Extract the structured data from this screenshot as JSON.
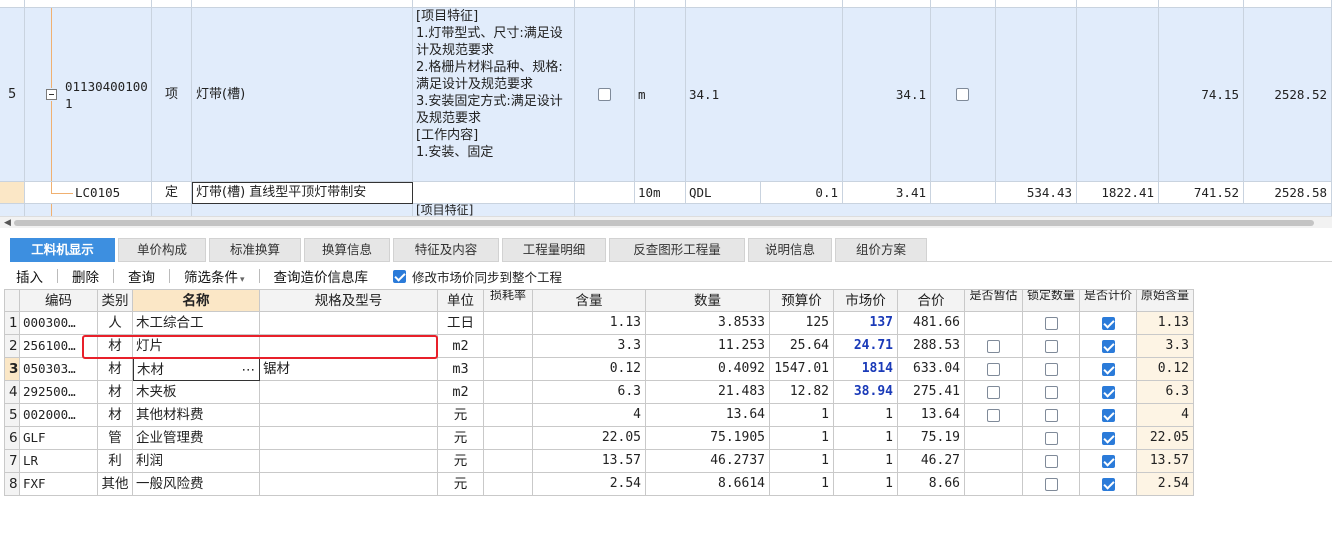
{
  "upper": {
    "row5": {
      "index": "5",
      "code": "011304001001",
      "type": "项",
      "name": "灯带(槽)",
      "features": [
        "[项目特征]",
        "1.灯带型式、尺寸:满足设计及规范要求",
        "2.格栅片材料品种、规格:满足设计及规范要求",
        "3.安装固定方式:满足设计及规范要求",
        "[工作内容]",
        "1.安装、固定"
      ],
      "unit": "m",
      "qty_expr": "34.1",
      "qty": "34.1",
      "unit_price": "74.15",
      "total": "2528.52"
    },
    "sub": {
      "code": "LC0105",
      "type": "定",
      "name": "灯带(槽) 直线型平顶灯带制安",
      "unit": "10m",
      "qty_expr": "QDL",
      "content": "0.1",
      "qty": "3.41",
      "labor": "534.43",
      "material": "1822.41",
      "unit_price": "741.52",
      "total": "2528.58"
    },
    "next_feature": "[项目特征]"
  },
  "tabs": [
    "工料机显示",
    "单价构成",
    "标准换算",
    "换算信息",
    "特征及内容",
    "工程量明细",
    "反查图形工程量",
    "说明信息",
    "组价方案"
  ],
  "toolbar": {
    "insert": "插入",
    "delete": "删除",
    "query": "查询",
    "filter": "筛选条件",
    "query_db": "查询造价信息库",
    "sync_label": "修改市场价同步到整个工程"
  },
  "lower": {
    "headers": {
      "code": "编码",
      "category": "类别",
      "name": "名称",
      "spec": "规格及型号",
      "unit": "单位",
      "loss": "损耗率",
      "content": "含量",
      "qty": "数量",
      "budget": "预算价",
      "market": "市场价",
      "total": "合价",
      "est": "是否暂估",
      "lock": "锁定数量",
      "pricing": "是否计价",
      "orig": "原始含量"
    },
    "rows": [
      {
        "no": "1",
        "code": "000300…",
        "cat": "人",
        "name": "木工综合工",
        "spec": "",
        "unit": "工日",
        "content": "1.13",
        "qty": "3.8533",
        "budget": "125",
        "market": "137",
        "total": "481.66",
        "est": null,
        "lock": false,
        "pricing": true,
        "orig": "1.13"
      },
      {
        "no": "2",
        "code": "256100…",
        "cat": "材",
        "name": "灯片",
        "spec": "",
        "unit": "m2",
        "content": "3.3",
        "qty": "11.253",
        "budget": "25.64",
        "market": "24.71",
        "total": "288.53",
        "est": false,
        "lock": false,
        "pricing": true,
        "orig": "3.3"
      },
      {
        "no": "3",
        "code": "050303…",
        "cat": "材",
        "name": "木材",
        "spec": "锯材",
        "unit": "m3",
        "content": "0.12",
        "qty": "0.4092",
        "budget": "1547.01",
        "market": "1814",
        "total": "633.04",
        "est": false,
        "lock": false,
        "pricing": true,
        "orig": "0.12"
      },
      {
        "no": "4",
        "code": "292500…",
        "cat": "材",
        "name": "木夹板",
        "spec": "",
        "unit": "m2",
        "content": "6.3",
        "qty": "21.483",
        "budget": "12.82",
        "market": "38.94",
        "total": "275.41",
        "est": false,
        "lock": false,
        "pricing": true,
        "orig": "6.3"
      },
      {
        "no": "5",
        "code": "002000…",
        "cat": "材",
        "name": "其他材料费",
        "spec": "",
        "unit": "元",
        "content": "4",
        "qty": "13.64",
        "budget": "1",
        "market": "1",
        "total": "13.64",
        "est": false,
        "lock": false,
        "pricing": true,
        "orig": "4"
      },
      {
        "no": "6",
        "code": "GLF",
        "cat": "管",
        "name": "企业管理费",
        "spec": "",
        "unit": "元",
        "content": "22.05",
        "qty": "75.1905",
        "budget": "1",
        "market": "1",
        "total": "75.19",
        "est": null,
        "lock": false,
        "pricing": true,
        "orig": "22.05"
      },
      {
        "no": "7",
        "code": "LR",
        "cat": "利",
        "name": "利润",
        "spec": "",
        "unit": "元",
        "content": "13.57",
        "qty": "46.2737",
        "budget": "1",
        "market": "1",
        "total": "46.27",
        "est": null,
        "lock": false,
        "pricing": true,
        "orig": "13.57"
      },
      {
        "no": "8",
        "code": "FXF",
        "cat": "其他",
        "name": "一般风险费",
        "spec": "",
        "unit": "元",
        "content": "2.54",
        "qty": "8.6614",
        "budget": "1",
        "market": "1",
        "total": "8.66",
        "est": null,
        "lock": false,
        "pricing": true,
        "orig": "2.54"
      }
    ]
  },
  "colors": {
    "selected_row_blue": "#e1ecfb",
    "active_tab": "#3d8fe0",
    "market_price": "#1a3ab8",
    "highlight_box": "#e8202a"
  },
  "icons": {
    "collapse": "minus-box-icon",
    "checkbox": "checkbox-icon",
    "ellipsis": "ellipsis-button-icon",
    "dropdown": "dropdown-arrow-icon",
    "scroll_left": "scroll-left-arrow-icon"
  }
}
